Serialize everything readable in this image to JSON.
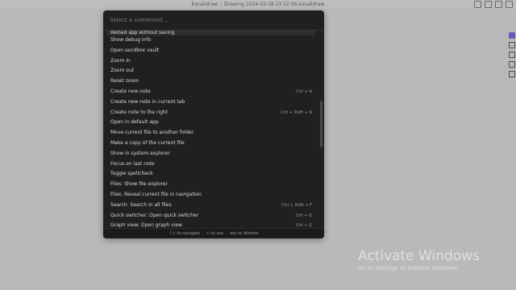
{
  "window": {
    "breadcrumb": [
      "Excalidraw",
      "Drawing 2024-03-18 23.52.56.excalidraw"
    ],
    "separator": "/"
  },
  "palette": {
    "placeholder": "Select a command...",
    "items": [
      {
        "label": "Reload app without saving",
        "hotkey": ""
      },
      {
        "label": "Show debug info",
        "hotkey": ""
      },
      {
        "label": "Open sandbox vault",
        "hotkey": ""
      },
      {
        "label": "Zoom in",
        "hotkey": ""
      },
      {
        "label": "Zoom out",
        "hotkey": ""
      },
      {
        "label": "Reset zoom",
        "hotkey": ""
      },
      {
        "label": "Create new note",
        "hotkey": "Ctrl + N"
      },
      {
        "label": "Create new note in current tab",
        "hotkey": ""
      },
      {
        "label": "Create note to the right",
        "hotkey": "Ctrl + Shift + N"
      },
      {
        "label": "Open in default app",
        "hotkey": ""
      },
      {
        "label": "Move current file to another folder",
        "hotkey": ""
      },
      {
        "label": "Make a copy of the current file",
        "hotkey": ""
      },
      {
        "label": "Show in system explorer",
        "hotkey": ""
      },
      {
        "label": "Focus on last note",
        "hotkey": ""
      },
      {
        "label": "Toggle spellcheck",
        "hotkey": ""
      },
      {
        "label": "Files: Show file explorer",
        "hotkey": ""
      },
      {
        "label": "Files: Reveal current file in navigation",
        "hotkey": ""
      },
      {
        "label": "Search: Search in all files",
        "hotkey": "Ctrl + Shift + F"
      },
      {
        "label": "Quick switcher: Open quick switcher",
        "hotkey": "Ctrl + O"
      },
      {
        "label": "Graph view: Open graph view",
        "hotkey": "Ctrl + G"
      }
    ],
    "footer": {
      "navigate": "↑↓ to navigate",
      "use": "↵ to use",
      "dismiss": "esc to dismiss"
    }
  },
  "watermark": {
    "title": "Activate Windows",
    "subtitle": "Go to Settings to activate Windows."
  },
  "colors": {
    "backdrop": "#b9b9b9",
    "palette_bg": "#202020",
    "accent": "#6b5bb6"
  }
}
